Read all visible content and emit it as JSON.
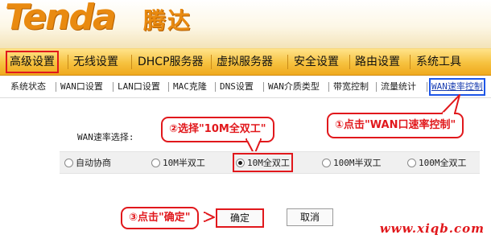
{
  "brand": {
    "logo_text": "Tenda",
    "logo_cn": "腾达",
    "accent": "#e98a10",
    "highlight": "#e1181c"
  },
  "main_menu": [
    {
      "label": "高级设置",
      "active": true
    },
    {
      "label": "无线设置"
    },
    {
      "label": "DHCP服务器"
    },
    {
      "label": "虚拟服务器"
    },
    {
      "label": "安全设置"
    },
    {
      "label": "路由设置"
    },
    {
      "label": "系统工具"
    }
  ],
  "sub_menu": [
    {
      "label": "系统状态"
    },
    {
      "label": "WAN口设置"
    },
    {
      "label": "LAN口设置"
    },
    {
      "label": "MAC克隆"
    },
    {
      "label": "DNS设置"
    },
    {
      "label": "WAN介质类型"
    },
    {
      "label": "带宽控制"
    },
    {
      "label": "流量统计"
    },
    {
      "label": "WAN速率控制",
      "active": true
    }
  ],
  "content": {
    "rate_label": "WAN速率选择:",
    "options": [
      {
        "label": "自动协商",
        "checked": false
      },
      {
        "label": "10M半双工",
        "checked": false
      },
      {
        "label": "10M全双工",
        "checked": true
      },
      {
        "label": "100M半双工",
        "checked": false
      },
      {
        "label": "100M全双工",
        "checked": false
      }
    ],
    "ok_label": "确定",
    "cancel_label": "取消"
  },
  "callouts": {
    "step1": "①点击\"WAN口速率控制\"",
    "step2": "②选择\"10M全双工\"",
    "step3": "③点击\"确定\""
  },
  "watermark": "www.xiqb.com"
}
